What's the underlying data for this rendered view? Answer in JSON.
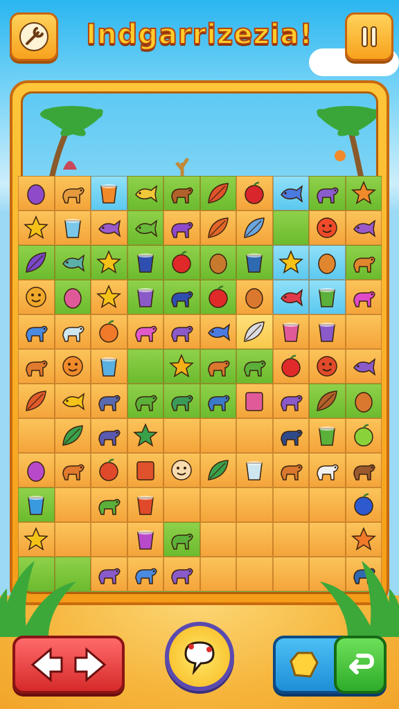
{
  "header": {
    "title": "Indgarrizezia!",
    "settings_icon": "wrench-icon",
    "pause_icon": "pause-icon"
  },
  "colors": {
    "tile_orange": "#f6ab3e",
    "tile_green": "#7cc63a",
    "tile_blue": "#6fd0f2",
    "frame": "#f7a21d",
    "title": "#ffcd2a"
  },
  "board": {
    "columns": 10,
    "rows": 12,
    "rows_data": [
      [
        [
          "o",
          "eggplant",
          "#8e4ac9"
        ],
        [
          "o",
          "deer",
          "#e39b3e"
        ],
        [
          "b",
          "cup",
          "#f28a2a"
        ],
        [
          "g",
          "snake",
          "#f0c93a"
        ],
        [
          "g",
          "boar",
          "#b3612a"
        ],
        [
          "g",
          "leaf",
          "#e0522b"
        ],
        [
          "o",
          "berry",
          "#d8262c"
        ],
        [
          "b",
          "worm",
          "#4a7be0"
        ],
        [
          "g",
          "squid",
          "#8a5dcf"
        ],
        [
          "g",
          "star",
          "#f08a2a"
        ]
      ],
      [
        [
          "o",
          "star",
          "#f5c318"
        ],
        [
          "o",
          "cup",
          "#79c8ea"
        ],
        [
          "o",
          "fish",
          "#9a5ac9"
        ],
        [
          "g",
          "bird",
          "#68b83a"
        ],
        [
          "o",
          "dino",
          "#8e4ac9"
        ],
        [
          "o",
          "plant",
          "#e0662a"
        ],
        [
          "o",
          "feather",
          "#6aa6e0"
        ],
        [
          "g",
          "empty",
          ""
        ],
        [
          "o",
          "smile",
          "#f04a2a"
        ],
        [
          "o",
          "bird",
          "#9a5ac9"
        ]
      ],
      [
        [
          "g",
          "fern",
          "#7848c8"
        ],
        [
          "g",
          "bird",
          "#5bb0a8"
        ],
        [
          "g",
          "star",
          "#f5c318"
        ],
        [
          "g",
          "vase",
          "#2e4fb0"
        ],
        [
          "g",
          "apple",
          "#e02a2a"
        ],
        [
          "g",
          "bread",
          "#c77a2e"
        ],
        [
          "g",
          "pot",
          "#2e6ab0"
        ],
        [
          "b",
          "star",
          "#f5c318"
        ],
        [
          "b",
          "cookie",
          "#e0862e"
        ],
        [
          "g",
          "horse",
          "#e0862e"
        ]
      ],
      [
        [
          "o",
          "sun",
          "#f0a82a"
        ],
        [
          "g",
          "egg",
          "#e05a9a"
        ],
        [
          "o",
          "star",
          "#f5c318"
        ],
        [
          "g",
          "cake",
          "#8a5ac9"
        ],
        [
          "g",
          "gorilla",
          "#2e4fb0"
        ],
        [
          "g",
          "apple",
          "#e02a2a"
        ],
        [
          "o",
          "cookie",
          "#d9782e"
        ],
        [
          "b",
          "bird",
          "#e03a4a"
        ],
        [
          "b",
          "hat",
          "#5bb03a"
        ],
        [
          "o",
          "monster",
          "#e04ac9"
        ]
      ],
      [
        [
          "o",
          "elephant",
          "#4a8ae0"
        ],
        [
          "o",
          "dino",
          "#cde6f0"
        ],
        [
          "o",
          "fruit",
          "#f07a2a"
        ],
        [
          "o",
          "flower",
          "#e05ac9"
        ],
        [
          "o",
          "dino",
          "#8a5ac9"
        ],
        [
          "o",
          "plane",
          "#4a7be0"
        ],
        [
          "y",
          "feather",
          "#d9dce0"
        ],
        [
          "o",
          "drum",
          "#e05a9a"
        ],
        [
          "o",
          "hat",
          "#8a5ac9"
        ],
        [
          "o",
          "empty",
          ""
        ]
      ],
      [
        [
          "o",
          "lion",
          "#e07a2e"
        ],
        [
          "o",
          "sun",
          "#f08a2a"
        ],
        [
          "o",
          "vase",
          "#5ab0e0"
        ],
        [
          "g",
          "empty",
          ""
        ],
        [
          "g",
          "star",
          "#f5b018"
        ],
        [
          "g",
          "elephant",
          "#d9782e"
        ],
        [
          "g",
          "lizard",
          "#5bb03a"
        ],
        [
          "o",
          "apple",
          "#e02a2a"
        ],
        [
          "o",
          "smile",
          "#e04a2a"
        ],
        [
          "o",
          "fish",
          "#8a5ac9"
        ]
      ],
      [
        [
          "o",
          "fire",
          "#e05a2a"
        ],
        [
          "o",
          "chick",
          "#f5c318"
        ],
        [
          "o",
          "bear",
          "#5a6ab0"
        ],
        [
          "g",
          "frog",
          "#5bb03a"
        ],
        [
          "g",
          "lizard",
          "#3a9a5a"
        ],
        [
          "g",
          "seal",
          "#3a7ac9"
        ],
        [
          "o",
          "shirt",
          "#e05a9a"
        ],
        [
          "o",
          "hippo",
          "#8a5ac9"
        ],
        [
          "g",
          "branch",
          "#b3612a"
        ],
        [
          "g",
          "bread",
          "#d9782e"
        ]
      ],
      [
        [
          "o",
          "empty",
          ""
        ],
        [
          "o",
          "fern",
          "#3aa04a"
        ],
        [
          "o",
          "bear",
          "#5a5ab0"
        ],
        [
          "o",
          "starfish",
          "#3aa04a"
        ],
        [
          "o",
          "empty",
          ""
        ],
        [
          "o",
          "empty",
          ""
        ],
        [
          "o",
          "empty",
          ""
        ],
        [
          "o",
          "bull",
          "#2e4a8a"
        ],
        [
          "o",
          "pot",
          "#5bb03a"
        ],
        [
          "o",
          "fruit",
          "#8ad23a"
        ]
      ],
      [
        [
          "o",
          "eggplant",
          "#b84ac9"
        ],
        [
          "o",
          "deer",
          "#e07a2e"
        ],
        [
          "o",
          "fruit",
          "#e04a2a"
        ],
        [
          "o",
          "book",
          "#e0522b"
        ],
        [
          "o",
          "smile",
          "#f8dcb0"
        ],
        [
          "o",
          "bush",
          "#3aa04a"
        ],
        [
          "o",
          "cup",
          "#cde6f0"
        ],
        [
          "o",
          "dino",
          "#d9782e"
        ],
        [
          "o",
          "sheep",
          "#f0f0f0"
        ],
        [
          "o",
          "horse",
          "#9a5a2e"
        ]
      ],
      [
        [
          "g",
          "vase",
          "#3a9ae0"
        ],
        [
          "o",
          "empty",
          ""
        ],
        [
          "o",
          "frog",
          "#5bb03a"
        ],
        [
          "o",
          "bowl",
          "#e04a2a"
        ],
        [
          "o",
          "empty",
          ""
        ],
        [
          "o",
          "empty",
          ""
        ],
        [
          "o",
          "empty",
          ""
        ],
        [
          "o",
          "empty",
          ""
        ],
        [
          "o",
          "empty",
          ""
        ],
        [
          "o",
          "fruit",
          "#2e5ad0"
        ]
      ],
      [
        [
          "o",
          "star",
          "#f5c318"
        ],
        [
          "o",
          "empty",
          ""
        ],
        [
          "o",
          "empty",
          ""
        ],
        [
          "o",
          "pot",
          "#b84ac9"
        ],
        [
          "g",
          "frog",
          "#5bb03a"
        ],
        [
          "o",
          "empty",
          ""
        ],
        [
          "o",
          "empty",
          ""
        ],
        [
          "o",
          "empty",
          ""
        ],
        [
          "o",
          "empty",
          ""
        ],
        [
          "o",
          "star",
          "#f07a2a"
        ]
      ],
      [
        [
          "g",
          "empty",
          ""
        ],
        [
          "g",
          "empty",
          ""
        ],
        [
          "o",
          "horse",
          "#8a5ac9"
        ],
        [
          "o",
          "elephant",
          "#4a8ae0"
        ],
        [
          "o",
          "dino",
          "#8a5ac9"
        ],
        [
          "o",
          "empty",
          ""
        ],
        [
          "o",
          "empty",
          ""
        ],
        [
          "o",
          "empty",
          ""
        ],
        [
          "o",
          "empty",
          ""
        ],
        [
          "o",
          "elephant",
          "#2e6ab0"
        ]
      ]
    ]
  },
  "controls": {
    "move_icon": "arrows-left-right-icon",
    "hint_icon": "chat-bubble-icon",
    "gem_icon": "gem-icon",
    "undo_icon": "undo-icon"
  }
}
